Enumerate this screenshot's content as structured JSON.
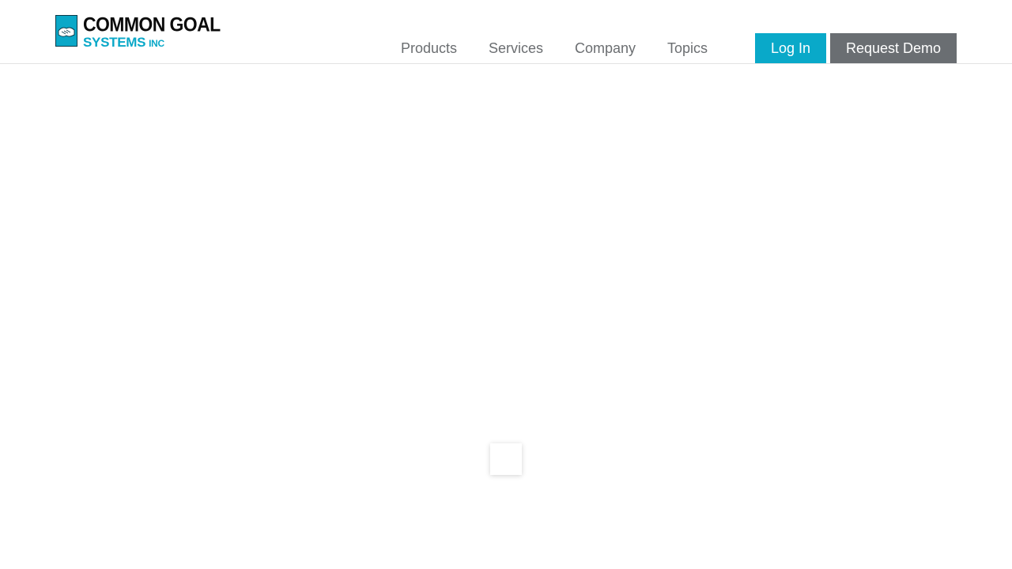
{
  "header": {
    "logo": {
      "line1": "COMMON GOAL",
      "line2": "SYSTEMS",
      "line2_suffix": "INC",
      "icon": "handshake-icon",
      "brand_color": "#0aa8c8"
    },
    "nav": [
      {
        "label": "Products"
      },
      {
        "label": "Services"
      },
      {
        "label": "Company"
      },
      {
        "label": "Topics"
      }
    ],
    "login_label": "Log In",
    "demo_label": "Request Demo",
    "login_color": "#09a9c9",
    "demo_color": "#6a6e72"
  },
  "main": {
    "loading_indicator": "loading-spinner"
  }
}
